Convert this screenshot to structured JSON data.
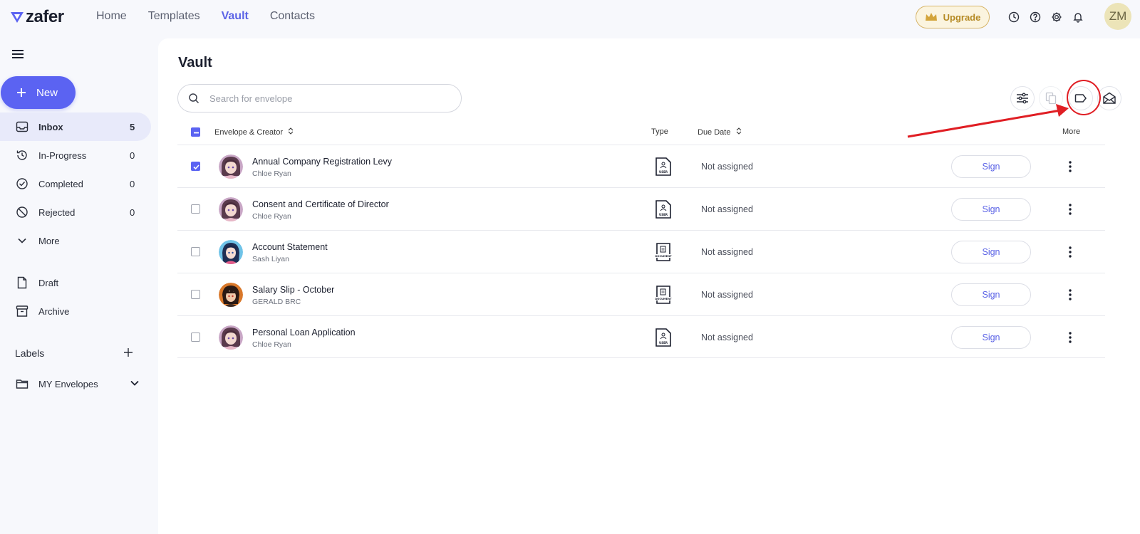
{
  "app": {
    "logo_text": "zafer",
    "nav": [
      {
        "label": "Home",
        "active": false
      },
      {
        "label": "Templates",
        "active": false
      },
      {
        "label": "Vault",
        "active": true
      },
      {
        "label": "Contacts",
        "active": false
      }
    ],
    "upgrade_label": "Upgrade",
    "avatar_initials": "ZM"
  },
  "sidebar": {
    "new_label": "New",
    "items": [
      {
        "label": "Inbox",
        "count": "5",
        "icon": "inbox-icon",
        "active": true
      },
      {
        "label": "In-Progress",
        "count": "0",
        "icon": "history-icon",
        "active": false
      },
      {
        "label": "Completed",
        "count": "0",
        "icon": "check-circle-icon",
        "active": false
      },
      {
        "label": "Rejected",
        "count": "0",
        "icon": "ban-icon",
        "active": false
      },
      {
        "label": "More",
        "count": "",
        "icon": "chevron-down-icon",
        "active": false
      },
      {
        "label": "Draft",
        "count": "",
        "icon": "file-icon",
        "active": false
      },
      {
        "label": "Archive",
        "count": "",
        "icon": "archive-icon",
        "active": false
      }
    ],
    "labels_title": "Labels",
    "label_items": [
      {
        "label": "MY Envelopes",
        "icon": "folder-icon"
      }
    ]
  },
  "main": {
    "title": "Vault",
    "search_placeholder": "Search for envelope",
    "columns": {
      "envelope": "Envelope & Creator",
      "type": "Type",
      "due": "Due Date",
      "more": "More"
    },
    "rows": [
      {
        "title": "Annual Company Registration Levy",
        "creator": "Chloe Ryan",
        "type": "USER",
        "due": "Not assigned",
        "action": "Sign",
        "checked": true
      },
      {
        "title": "Consent and Certificate of Director",
        "creator": "Chloe Ryan",
        "type": "USER",
        "due": "Not assigned",
        "action": "Sign",
        "checked": false
      },
      {
        "title": "Account Statement",
        "creator": "Sash Liyan",
        "type": "DOCUMENT",
        "due": "Not assigned",
        "action": "Sign",
        "checked": false
      },
      {
        "title": "Salary Slip - October",
        "creator": "GERALD BRC",
        "type": "DOCUMENT",
        "due": "Not assigned",
        "action": "Sign",
        "checked": false
      },
      {
        "title": "Personal Loan Application",
        "creator": "Chloe Ryan",
        "type": "USER",
        "due": "Not assigned",
        "action": "Sign",
        "checked": false
      }
    ]
  },
  "colors": {
    "accent": "#5b63f2",
    "highlight": "#e01e24",
    "upgrade_gold": "#b58a24"
  }
}
